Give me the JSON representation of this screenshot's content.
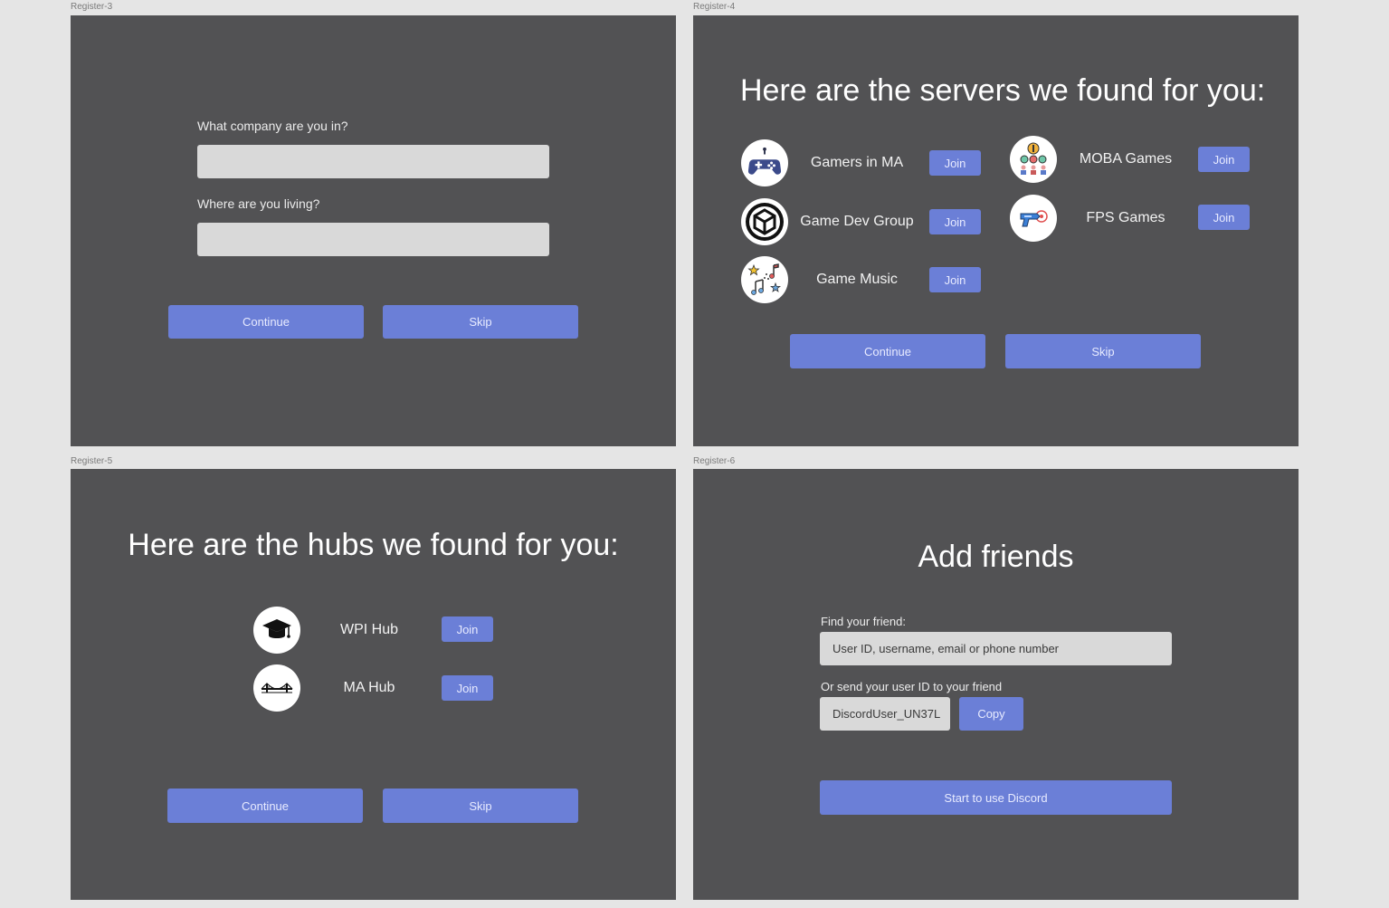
{
  "frames": {
    "register3": {
      "label": "Register-3",
      "company_question": "What company are you in?",
      "living_question": "Where are you living?",
      "continue_label": "Continue",
      "skip_label": "Skip"
    },
    "register4": {
      "label": "Register-4",
      "heading": "Here are the servers we found for you:",
      "servers": [
        {
          "name": "Gamers in MA",
          "join": "Join",
          "icon": "gamepad-icon"
        },
        {
          "name": "MOBA Games",
          "join": "Join",
          "icon": "moba-icon"
        },
        {
          "name": "Game Dev Group",
          "join": "Join",
          "icon": "unity-icon"
        },
        {
          "name": "FPS Games",
          "join": "Join",
          "icon": "laser-gun-icon"
        },
        {
          "name": "Game Music",
          "join": "Join",
          "icon": "music-notes-icon"
        }
      ],
      "continue_label": "Continue",
      "skip_label": "Skip"
    },
    "register5": {
      "label": "Register-5",
      "heading": "Here are the hubs we found for you:",
      "hubs": [
        {
          "name": "WPI Hub",
          "join": "Join",
          "icon": "graduation-cap-icon"
        },
        {
          "name": "MA Hub",
          "join": "Join",
          "icon": "bridge-icon"
        }
      ],
      "continue_label": "Continue",
      "skip_label": "Skip"
    },
    "register6": {
      "label": "Register-6",
      "heading": "Add friends",
      "find_label": "Find your friend:",
      "find_placeholder": "User ID, username, email or phone number",
      "send_label": "Or send your user ID to your friend",
      "user_id": "DiscordUser_UN37L",
      "copy_label": "Copy",
      "start_label": "Start to use Discord"
    }
  },
  "colors": {
    "background": "#e5e5e5",
    "frame": "#525254",
    "accent": "#6b7fd7",
    "input": "#d9d9d9"
  }
}
